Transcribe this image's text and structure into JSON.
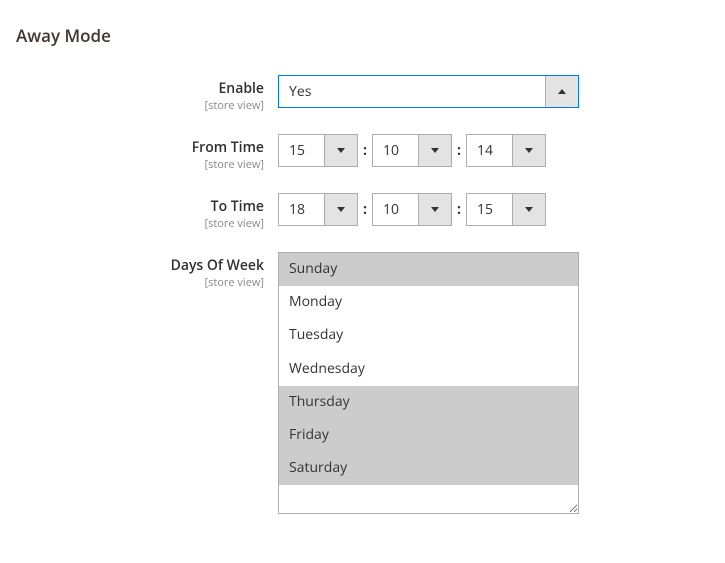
{
  "section": {
    "title": "Away Mode"
  },
  "scope_label": "[store view]",
  "enable": {
    "label": "Enable",
    "value": "Yes"
  },
  "from_time": {
    "label": "From Time",
    "h": "15",
    "m": "10",
    "s": "14"
  },
  "to_time": {
    "label": "To Time",
    "h": "18",
    "m": "10",
    "s": "15"
  },
  "days": {
    "label": "Days Of Week",
    "options": [
      {
        "label": "Sunday",
        "selected": true
      },
      {
        "label": "Monday",
        "selected": false
      },
      {
        "label": "Tuesday",
        "selected": false
      },
      {
        "label": "Wednesday",
        "selected": false
      },
      {
        "label": "Thursday",
        "selected": true
      },
      {
        "label": "Friday",
        "selected": true
      },
      {
        "label": "Saturday",
        "selected": true
      }
    ]
  },
  "colon": ":"
}
